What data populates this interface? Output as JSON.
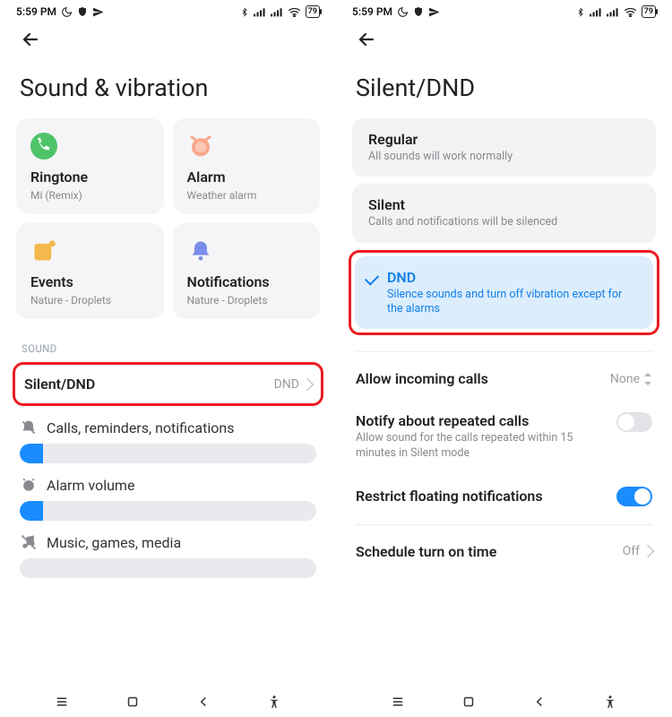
{
  "status": {
    "time": "5:59 PM",
    "battery": "79"
  },
  "left": {
    "title": "Sound & vibration",
    "tiles": [
      {
        "label": "Ringtone",
        "sub": "Mi (Remix)"
      },
      {
        "label": "Alarm",
        "sub": "Weather alarm"
      },
      {
        "label": "Events",
        "sub": "Nature - Droplets"
      },
      {
        "label": "Notifications",
        "sub": "Nature - Droplets"
      }
    ],
    "section_sound": "SOUND",
    "silent_row": {
      "title": "Silent/DND",
      "value": "DND"
    },
    "sliders": {
      "calls": {
        "label": "Calls, reminders, notifications",
        "percent": 8
      },
      "alarm": {
        "label": "Alarm volume",
        "percent": 8
      },
      "media": {
        "label": "Music, games, media",
        "percent": 0
      }
    }
  },
  "right": {
    "title": "Silent/DND",
    "options": [
      {
        "title": "Regular",
        "sub": "All sounds will work normally"
      },
      {
        "title": "Silent",
        "sub": "Calls and notifications will be silenced"
      },
      {
        "title": "DND",
        "sub": "Silence sounds and turn off vibration except for the alarms"
      }
    ],
    "rows": {
      "allow_calls": {
        "title": "Allow incoming calls",
        "value": "None"
      },
      "repeated": {
        "title": "Notify about repeated calls",
        "sub": "Allow sound for the calls repeated within 15 minutes in Silent mode"
      },
      "restrict": {
        "title": "Restrict floating notifications"
      },
      "schedule": {
        "title": "Schedule turn on time",
        "value": "Off"
      }
    }
  }
}
